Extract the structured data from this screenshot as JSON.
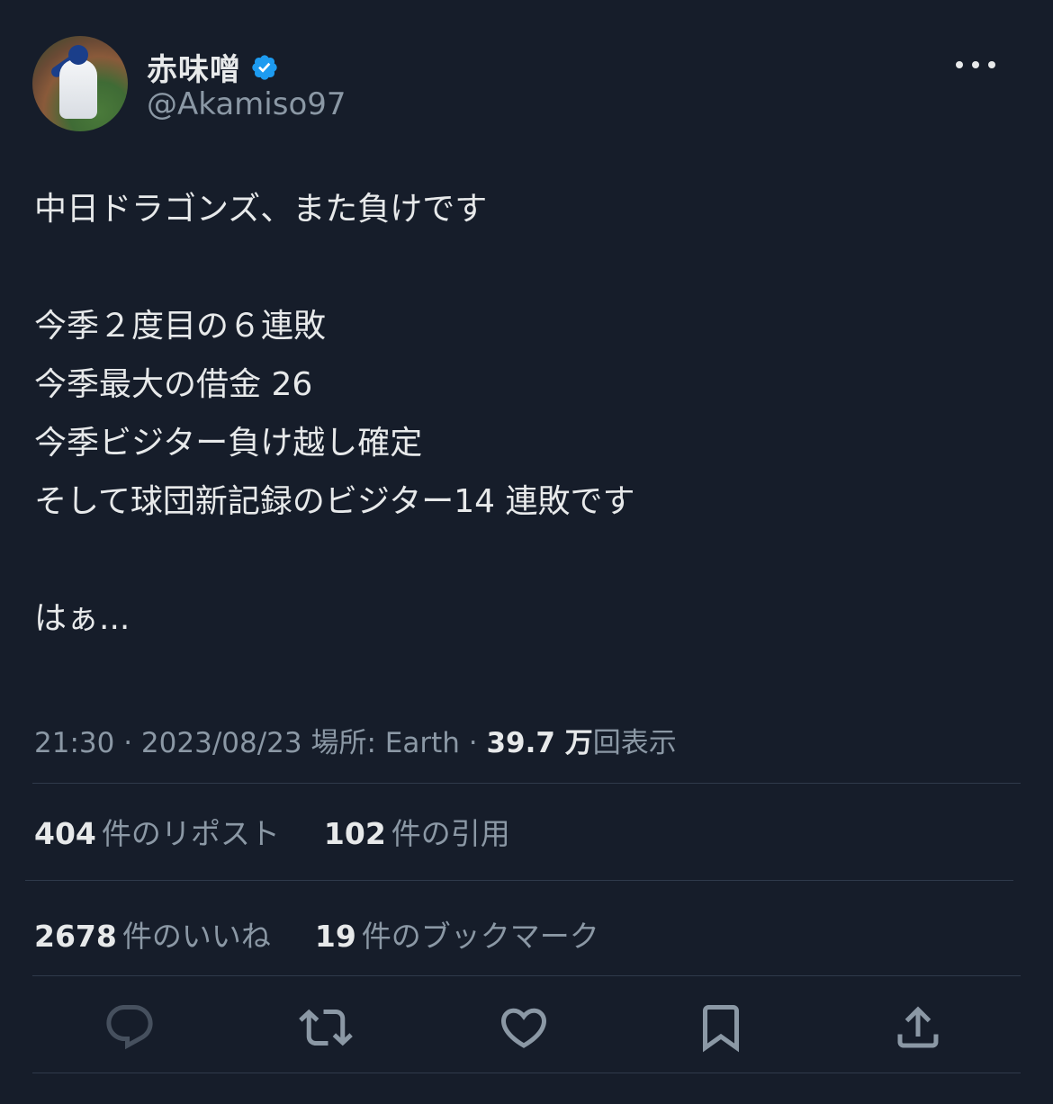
{
  "author": {
    "display_name": "赤味噌",
    "handle": "@Akamiso97",
    "verified_icon": "verified-badge-icon",
    "avatar_icon": "avatar"
  },
  "more_icon": "more-options-icon",
  "tweet": {
    "lines": [
      "中日ドラゴンズ、また負けです",
      "",
      "今季２度目の６連敗",
      "今季最大の借金 26",
      "今季ビジター負け越し確定",
      "そして球団新記録のビジター14 連敗です",
      "",
      "はぁ..."
    ]
  },
  "meta": {
    "time": "21:30",
    "date": "2023/08/23",
    "location_label": "場所: Earth",
    "views_count": "39.7 万",
    "views_label": "回表示",
    "separator": "·"
  },
  "stats": {
    "reposts_count": "404",
    "reposts_label": "件のリポスト",
    "quotes_count": "102",
    "quotes_label": "件の引用",
    "likes_count": "2678",
    "likes_label": "件のいいね",
    "bookmarks_count": "19",
    "bookmarks_label": "件のブックマーク"
  },
  "actions": [
    "reply-icon",
    "repost-icon",
    "like-icon",
    "bookmark-icon",
    "share-icon"
  ],
  "colors": {
    "background": "#161d2a",
    "primary_text": "#e7e9ea",
    "secondary_text": "#8b98a5",
    "verified": "#1d9bf0",
    "divider": "#2f3a4b"
  }
}
